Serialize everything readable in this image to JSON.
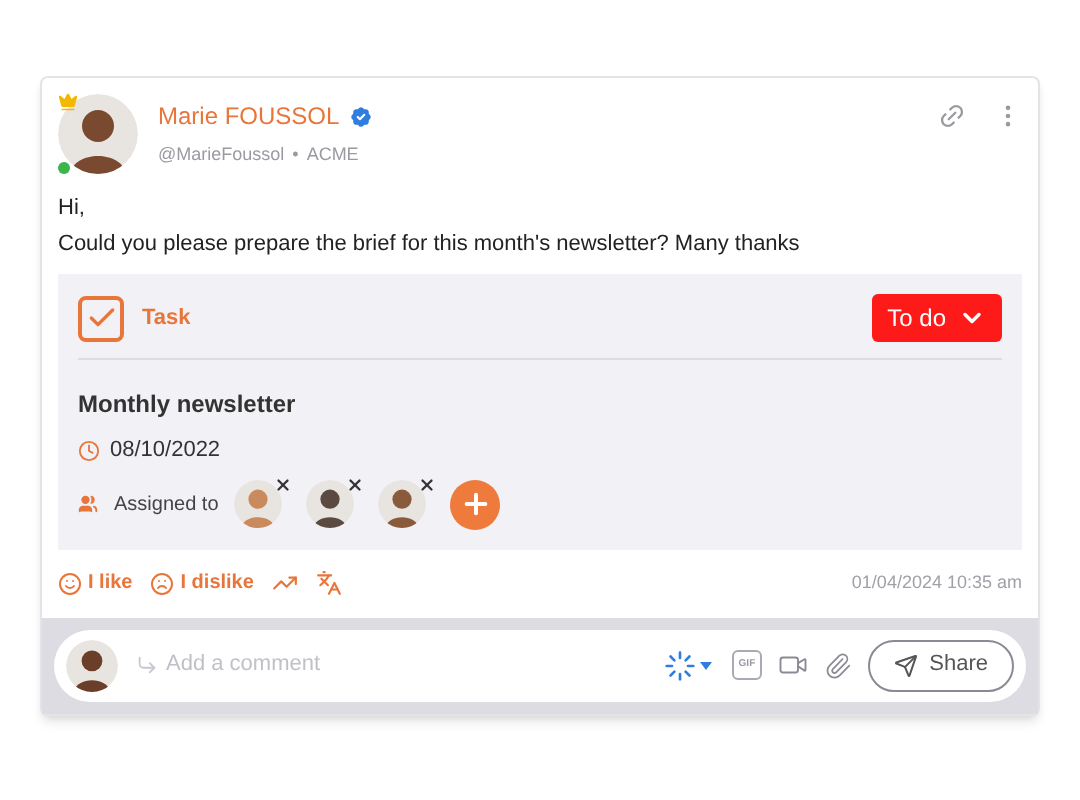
{
  "post": {
    "author": "Marie FOUSSOL",
    "verified": true,
    "online": true,
    "handle": "@MarieFoussol",
    "separator": "•",
    "company": "ACME",
    "message": [
      "Hi,",
      "Could you please prepare the brief for this month's newsletter? Many thanks"
    ]
  },
  "task": {
    "kind_label": "Task",
    "done": true,
    "status": "To do",
    "title": "Monthly newsletter",
    "due": "08/10/2022",
    "assigned_label": "Assigned to",
    "assignees": [
      {
        "removable": true
      },
      {
        "removable": true
      },
      {
        "removable": true
      }
    ]
  },
  "actions": [
    {
      "kind": "like",
      "label": "I like"
    },
    {
      "kind": "dislike",
      "label": "I dislike"
    },
    {
      "kind": "stats"
    },
    {
      "kind": "translate"
    }
  ],
  "timestamp": "01/04/2024 10:35 am",
  "comment": {
    "placeholder": "Add a comment",
    "gif_label": "GIF",
    "share": "Share"
  }
}
